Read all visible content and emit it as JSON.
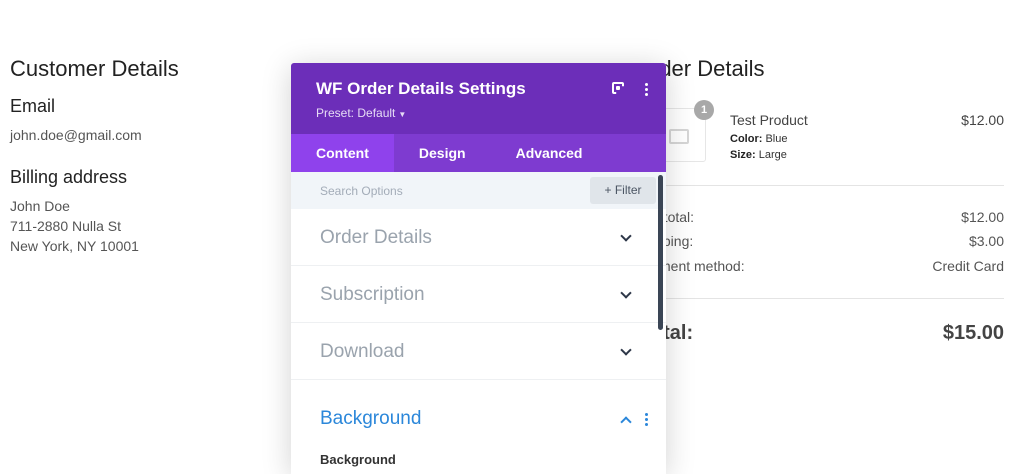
{
  "customer": {
    "heading": "Customer Details",
    "email_label": "Email",
    "email": "john.doe@gmail.com",
    "billing_label": "Billing address",
    "billing_lines": [
      "John Doe",
      "711-2880 Nulla St",
      "New York, NY 10001"
    ]
  },
  "order": {
    "heading": "rder Details",
    "item": {
      "quantity": "1",
      "name": "Test Product",
      "color_label": "Color:",
      "color": "Blue",
      "size_label": "Size:",
      "size": "Large",
      "price": "$12.00"
    },
    "summary": [
      {
        "label": "ıbtotal:",
        "value": "$12.00"
      },
      {
        "label": "ipping:",
        "value": "$3.00"
      },
      {
        "label": "yment method:",
        "value": "Credit Card"
      }
    ],
    "total_label": "ɔtal:",
    "total_value": "$15.00"
  },
  "modal": {
    "title": "WF Order Details Settings",
    "preset": "Preset: Default",
    "tabs": [
      "Content",
      "Design",
      "Advanced"
    ],
    "active_tab": "Content",
    "search_placeholder": "Search Options",
    "filter_label": "+ Filter",
    "sections": [
      "Order Details",
      "Subscription",
      "Download"
    ],
    "open_section": "Background",
    "open_section_sublabel": "Background"
  },
  "colors": {
    "modal_header": "#6c2eb9",
    "modal_tabs": "#7e3bd0",
    "tab_active": "#8f42ec",
    "accent_blue": "#2b87da"
  },
  "icons": [
    "expand-icon",
    "kebab-menu-icon",
    "chevron-down-icon",
    "chevron-up-icon",
    "image-placeholder-icon"
  ]
}
